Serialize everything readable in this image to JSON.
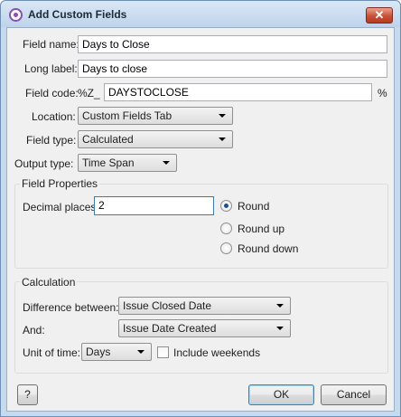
{
  "window": {
    "title": "Add Custom Fields",
    "close_glyph": "✕"
  },
  "fields": {
    "name_label": "Field name:",
    "name_value": "Days to Close",
    "long_label_label": "Long label:",
    "long_label_value": "Days to close",
    "code_label": "Field code:",
    "code_prefix": "%Z_",
    "code_value": "DAYSTOCLOSE",
    "code_suffix": "%",
    "location_label": "Location:",
    "location_value": "Custom Fields Tab",
    "type_label": "Field type:",
    "type_value": "Calculated",
    "output_label": "Output type:",
    "output_value": "Time Span"
  },
  "field_properties": {
    "title": "Field Properties",
    "decimal_label": "Decimal places:",
    "decimal_value": "2",
    "rounding": [
      {
        "label": "Round",
        "checked": true
      },
      {
        "label": "Round up",
        "checked": false
      },
      {
        "label": "Round down",
        "checked": false
      }
    ]
  },
  "calculation": {
    "title": "Calculation",
    "difference_label": "Difference between:",
    "difference_value": "Issue Closed Date",
    "and_label": "And:",
    "and_value": "Issue Date Created",
    "unit_label": "Unit of time:",
    "unit_value": "Days",
    "weekends_label": "Include weekends",
    "weekends_checked": false
  },
  "buttons": {
    "help": "?",
    "ok": "OK",
    "cancel": "Cancel"
  }
}
